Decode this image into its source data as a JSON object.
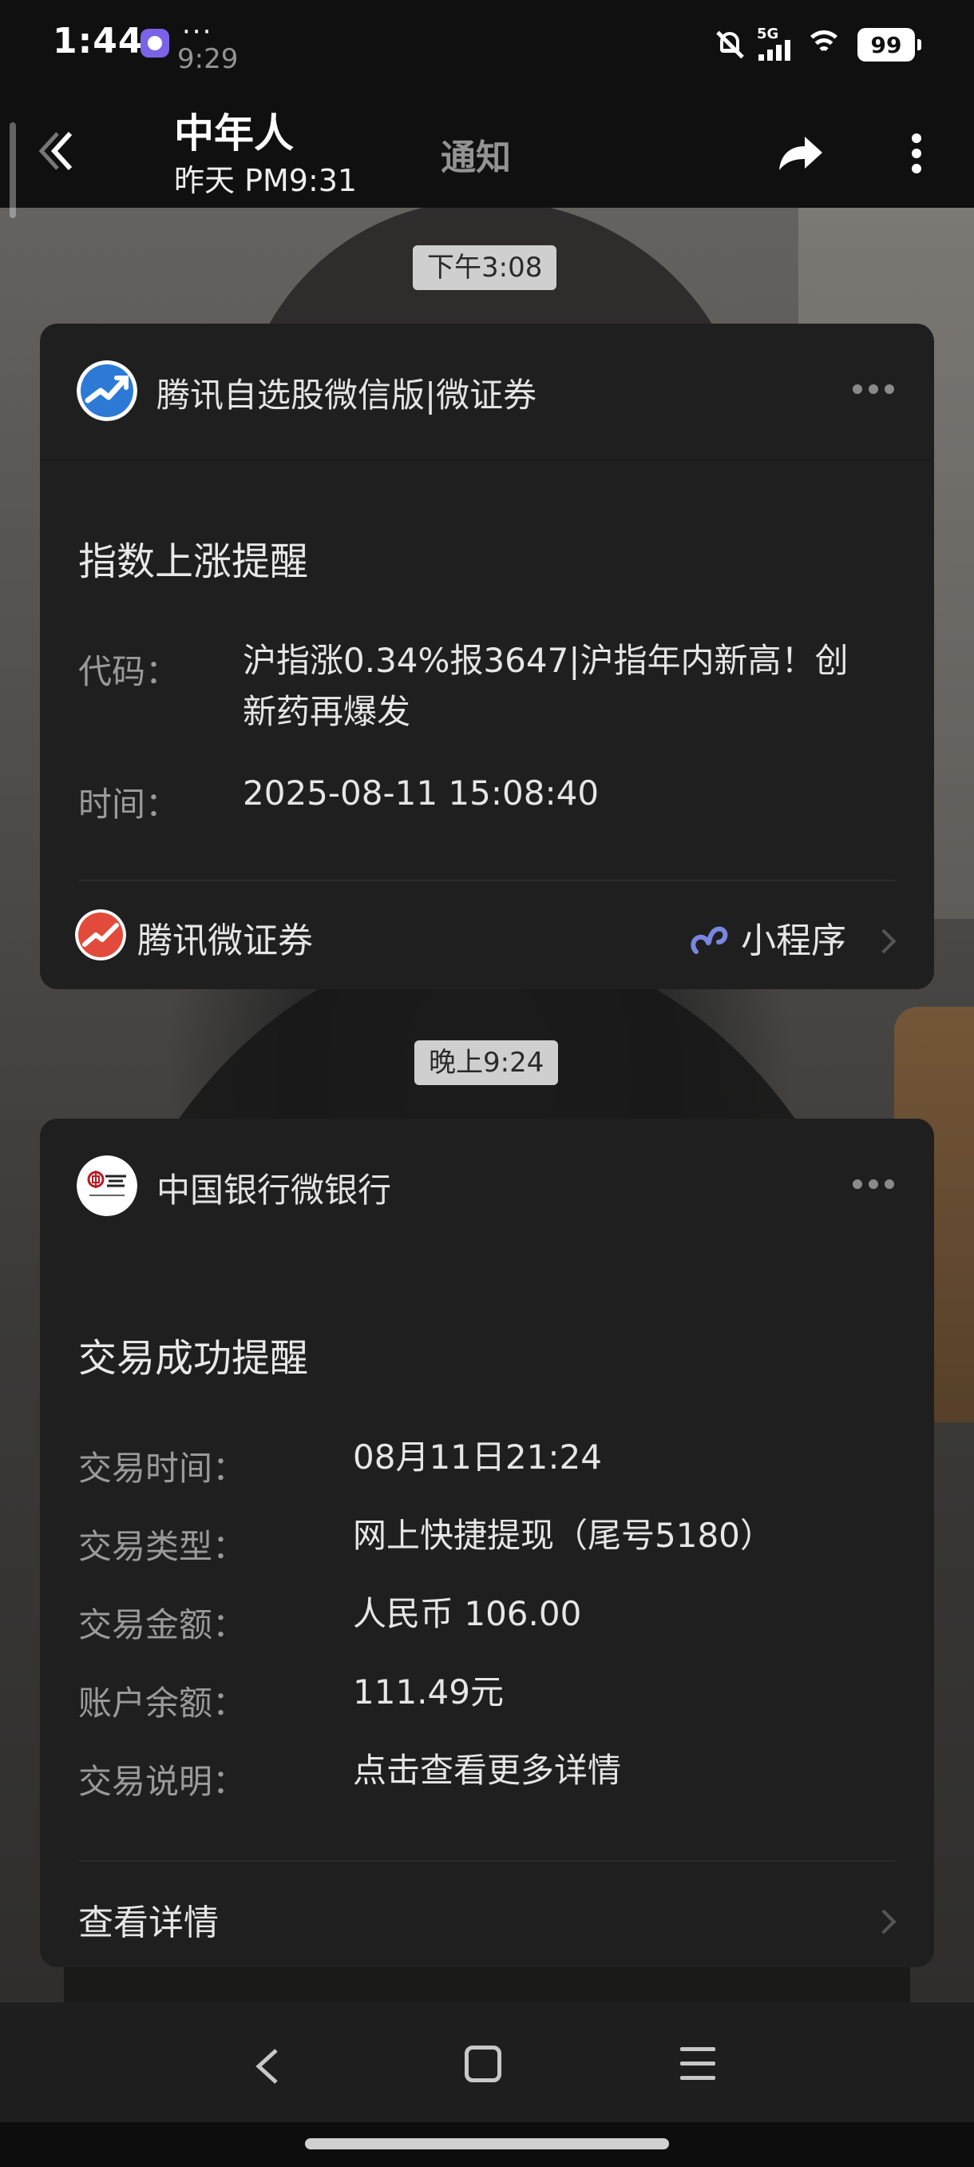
{
  "status_bar": {
    "time": "1:44",
    "more": "···",
    "ghost_time": "9:29",
    "network": "5G",
    "battery": "99"
  },
  "header": {
    "title": "中年人",
    "subtitle": "昨天 PM9:31",
    "tab": "通知"
  },
  "messages": [
    {
      "timestamp": "下午3:08",
      "source": "腾讯自选股微信版|微证券",
      "title": "指数上涨提醒",
      "rows": [
        {
          "label": "代码：",
          "value_line1": "沪指涨0.34%报3647|沪指年内新高！创",
          "value_line2": "新药再爆发"
        },
        {
          "label": "时间：",
          "value_line1": "2025-08-11 15:08:40"
        }
      ],
      "footer_name": "腾讯微证券",
      "footer_tag": "小程序"
    },
    {
      "timestamp": "晚上9:24",
      "source": "中国银行微银行",
      "title": "交易成功提醒",
      "rows": [
        {
          "label": "交易时间：",
          "value": "08月11日21:24"
        },
        {
          "label": "交易类型：",
          "value": "网上快捷提现（尾号5180）"
        },
        {
          "label": "交易金额：",
          "value": "人民币 106.00"
        },
        {
          "label": "账户余额：",
          "value": "111.49元"
        },
        {
          "label": "交易说明：",
          "value": "点击查看更多详情"
        }
      ],
      "footer_link": "查看详情"
    }
  ],
  "colors": {
    "card_bg": "#1f1f1f",
    "timestamp_bg": "#cfcfcf",
    "miniprogram_accent": "#7a86e0",
    "boc_red": "#b81c22"
  }
}
